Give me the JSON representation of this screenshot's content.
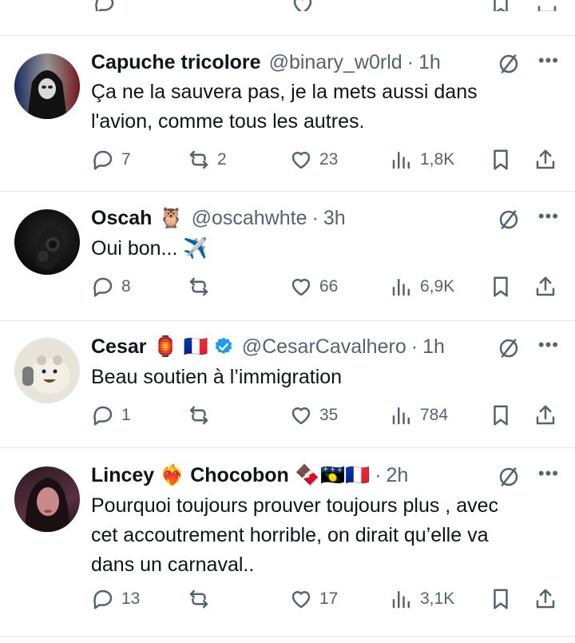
{
  "tweets": [
    {
      "name": "Capuche tricolore",
      "handle": "@binary_w0rld",
      "time": "1h",
      "text_lines": [
        "Ça ne la sauvera pas, je la mets aussi dans",
        "l'avion, comme tous les autres."
      ],
      "replies": "7",
      "reposts": "2",
      "likes": "23",
      "views": "1,8K"
    },
    {
      "name": "Oscah",
      "name_emoji": "🦉",
      "handle": "@oscahwhte",
      "time": "3h",
      "text_lines": [
        "Oui bon... ✈️"
      ],
      "replies": "8",
      "reposts": "",
      "likes": "66",
      "views": "6,9K"
    },
    {
      "name": "Cesar",
      "name_emoji": "🏮 🇫🇷",
      "verified": true,
      "handle": "@CesarCavalhero",
      "time": "1h",
      "text_lines": [
        "Beau soutien à l’immigration"
      ],
      "replies": "1",
      "reposts": "",
      "likes": "35",
      "views": "784"
    },
    {
      "name": "Lincey ❤️‍🔥 Chocobon",
      "name_emoji": "🍫🇬🇵🇫🇷",
      "handle": "",
      "time": "2h",
      "text_lines": [
        "Pourquoi toujours prouver toujours plus , avec",
        "cet accoutrement horrible, on dirait qu’elle va",
        "dans un carnaval.."
      ],
      "replies": "13",
      "reposts": "",
      "likes": "17",
      "views": "3,1K"
    }
  ],
  "colors": {
    "text": "#0f1419",
    "secondary": "#536471",
    "verified": "#1d9bf0",
    "divider": "#e1e6ea"
  },
  "icons": [
    "reply-icon",
    "repost-icon",
    "like-icon",
    "views-icon",
    "bookmark-icon",
    "share-icon",
    "grok-icon",
    "more-icon"
  ]
}
